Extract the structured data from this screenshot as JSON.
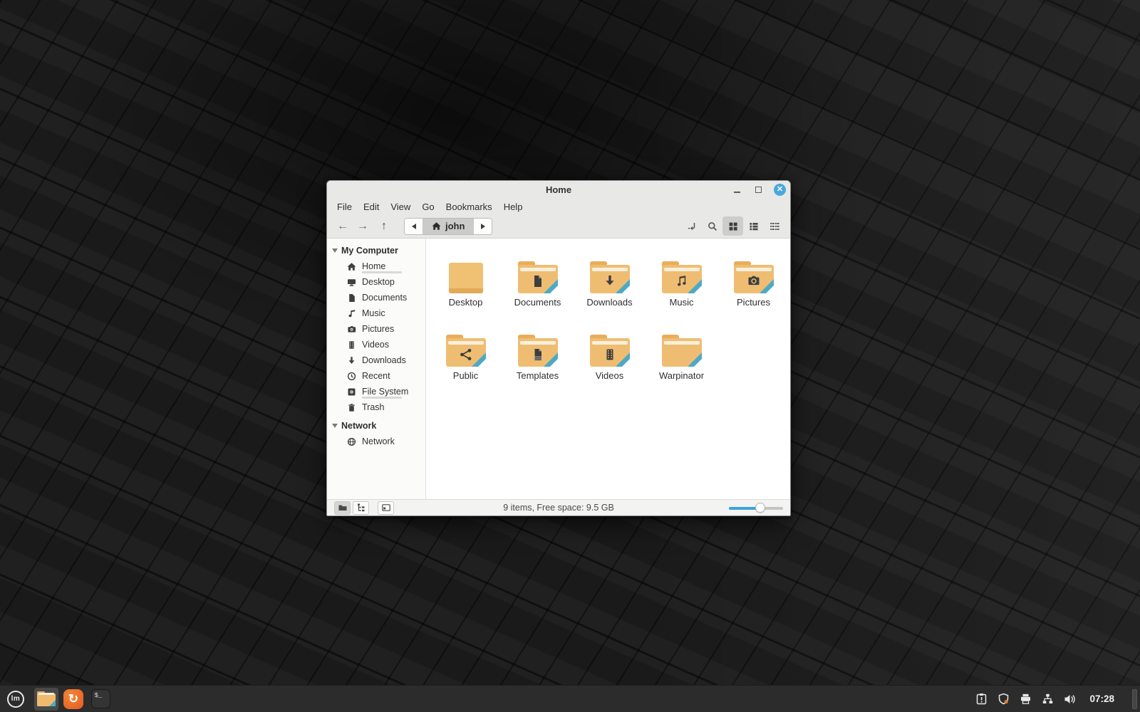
{
  "window": {
    "title": "Home",
    "menu": [
      "File",
      "Edit",
      "View",
      "Go",
      "Bookmarks",
      "Help"
    ],
    "toolbar": {
      "path_current": "john",
      "icons": [
        "back-arrow-icon",
        "forward-arrow-icon",
        "up-arrow-icon",
        "toggle-location-entry-icon",
        "search-icon",
        "grid-view-icon",
        "list-view-icon",
        "compact-view-icon"
      ],
      "active_view": "grid"
    },
    "sidebar": {
      "my_computer": {
        "header": "My Computer",
        "items": [
          {
            "label": "Home",
            "icon": "home-icon",
            "usage": 0.62,
            "active": true
          },
          {
            "label": "Desktop",
            "icon": "desktop-icon"
          },
          {
            "label": "Documents",
            "icon": "document-icon"
          },
          {
            "label": "Music",
            "icon": "music-note-icon"
          },
          {
            "label": "Pictures",
            "icon": "camera-icon"
          },
          {
            "label": "Videos",
            "icon": "film-icon"
          },
          {
            "label": "Downloads",
            "icon": "download-arrow-icon"
          },
          {
            "label": "Recent",
            "icon": "clock-icon"
          },
          {
            "label": "File System",
            "icon": "drive-icon",
            "usage": 0.62
          },
          {
            "label": "Trash",
            "icon": "trash-icon"
          }
        ]
      },
      "network_section": {
        "header": "Network",
        "items": [
          {
            "label": "Network",
            "icon": "globe-icon"
          }
        ]
      }
    },
    "files": [
      {
        "name": "Desktop",
        "icon": "desktop-pane-icon"
      },
      {
        "name": "Documents",
        "icon": "document-glyph-icon"
      },
      {
        "name": "Downloads",
        "icon": "download-glyph-icon"
      },
      {
        "name": "Music",
        "icon": "music-glyph-icon"
      },
      {
        "name": "Pictures",
        "icon": "camera-glyph-icon"
      },
      {
        "name": "Public",
        "icon": "share-glyph-icon"
      },
      {
        "name": "Templates",
        "icon": "template-glyph-icon"
      },
      {
        "name": "Videos",
        "icon": "film-glyph-icon"
      },
      {
        "name": "Warpinator",
        "icon": "plain-folder-icon"
      }
    ],
    "statusbar": {
      "summary": "9 items, Free space: 9.5 GB",
      "zoom_level": 0.58,
      "buttons": [
        "show-places-icon",
        "show-treeview-icon",
        "toggle-sidepane-icon"
      ]
    }
  },
  "taskbar": {
    "clock": "07:28",
    "launchers": [
      {
        "icon": "mint-menu-icon"
      },
      {
        "icon": "files-app-icon",
        "active": true
      },
      {
        "icon": "firefox-icon"
      },
      {
        "icon": "terminal-icon"
      }
    ],
    "tray": [
      {
        "icon": "clipboard-alert-icon"
      },
      {
        "icon": "shield-icon"
      },
      {
        "icon": "printer-icon"
      },
      {
        "icon": "network-icon"
      },
      {
        "icon": "volume-icon"
      }
    ]
  },
  "colors": {
    "accent": "#3ca3dc",
    "close_button": "#49a8dd",
    "folder_body": "#efbd72",
    "folder_corner": "#4da9c4",
    "chrome_bg": "#e8e8e7",
    "panel_bg": "#2c2c2c"
  }
}
